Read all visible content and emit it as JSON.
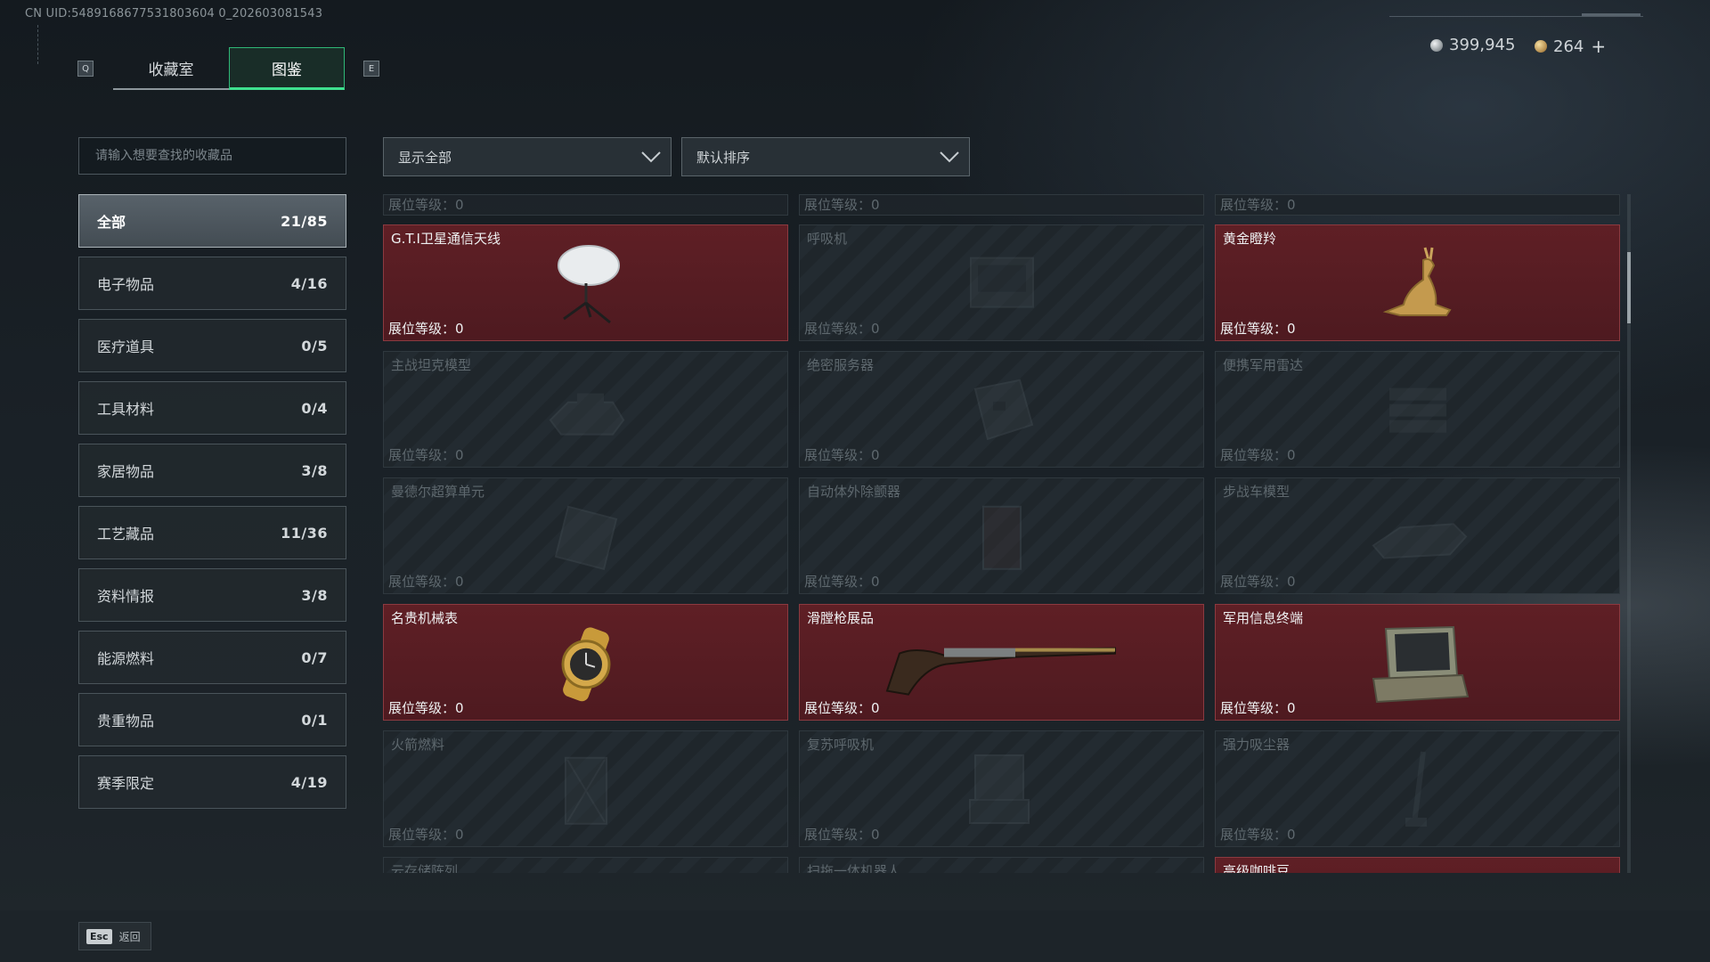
{
  "uid_text": "CN UID:5489168677531803604 0_202603081543",
  "tabs": {
    "left_key": "Q",
    "right_key": "E",
    "items": [
      "收藏室",
      "图鉴"
    ],
    "active": "图鉴"
  },
  "currency": {
    "silver": "399,945",
    "gold": "264",
    "plus": "+"
  },
  "search": {
    "placeholder": "请输入想要查找的收藏品"
  },
  "filters": {
    "display": "显示全部",
    "sort": "默认排序"
  },
  "categories": [
    {
      "label": "全部",
      "count": "21/85",
      "active": true
    },
    {
      "label": "电子物品",
      "count": "4/16"
    },
    {
      "label": "医疗道具",
      "count": "0/5"
    },
    {
      "label": "工具材料",
      "count": "0/4"
    },
    {
      "label": "家居物品",
      "count": "3/8"
    },
    {
      "label": "工艺藏品",
      "count": "11/36"
    },
    {
      "label": "资料情报",
      "count": "3/8"
    },
    {
      "label": "能源燃料",
      "count": "0/7"
    },
    {
      "label": "贵重物品",
      "count": "0/1"
    },
    {
      "label": "赛季限定",
      "count": "4/19"
    }
  ],
  "level_label": "展位等级：",
  "level_value": "0",
  "top_strip": [
    "展位等级：0",
    "展位等级：0",
    "展位等级：0"
  ],
  "items": [
    {
      "name": "G.T.I卫星通信天线",
      "owned": true,
      "icon": "satellite-dish"
    },
    {
      "name": "呼吸机",
      "owned": false,
      "icon": "ventilator"
    },
    {
      "name": "黄金瞪羚",
      "owned": true,
      "icon": "golden-gazelle"
    },
    {
      "name": "主战坦克模型",
      "owned": false,
      "icon": "tank-model"
    },
    {
      "name": "绝密服务器",
      "owned": false,
      "icon": "server"
    },
    {
      "name": "便携军用雷达",
      "owned": false,
      "icon": "radar"
    },
    {
      "name": "曼德尔超算单元",
      "owned": false,
      "icon": "supercomputer"
    },
    {
      "name": "自动体外除颤器",
      "owned": false,
      "icon": "defibrillator"
    },
    {
      "name": "步战车模型",
      "owned": false,
      "icon": "ifv-model"
    },
    {
      "name": "名贵机械表",
      "owned": true,
      "icon": "watch"
    },
    {
      "name": "滑膛枪展品",
      "owned": true,
      "icon": "musket"
    },
    {
      "name": "军用信息终端",
      "owned": true,
      "icon": "terminal"
    },
    {
      "name": "火箭燃料",
      "owned": false,
      "icon": "rocket-fuel"
    },
    {
      "name": "复苏呼吸机",
      "owned": false,
      "icon": "resuscitator"
    },
    {
      "name": "强力吸尘器",
      "owned": false,
      "icon": "vacuum"
    },
    {
      "name": "云存储阵列",
      "owned": false,
      "icon": "storage-array"
    },
    {
      "name": "扫拖一体机器人",
      "owned": false,
      "icon": "robot-vacuum"
    },
    {
      "name": "高级咖啡豆",
      "owned": true,
      "icon": "coffee-beans"
    }
  ],
  "footer": {
    "esc_key": "Esc",
    "back_label": "返回"
  }
}
